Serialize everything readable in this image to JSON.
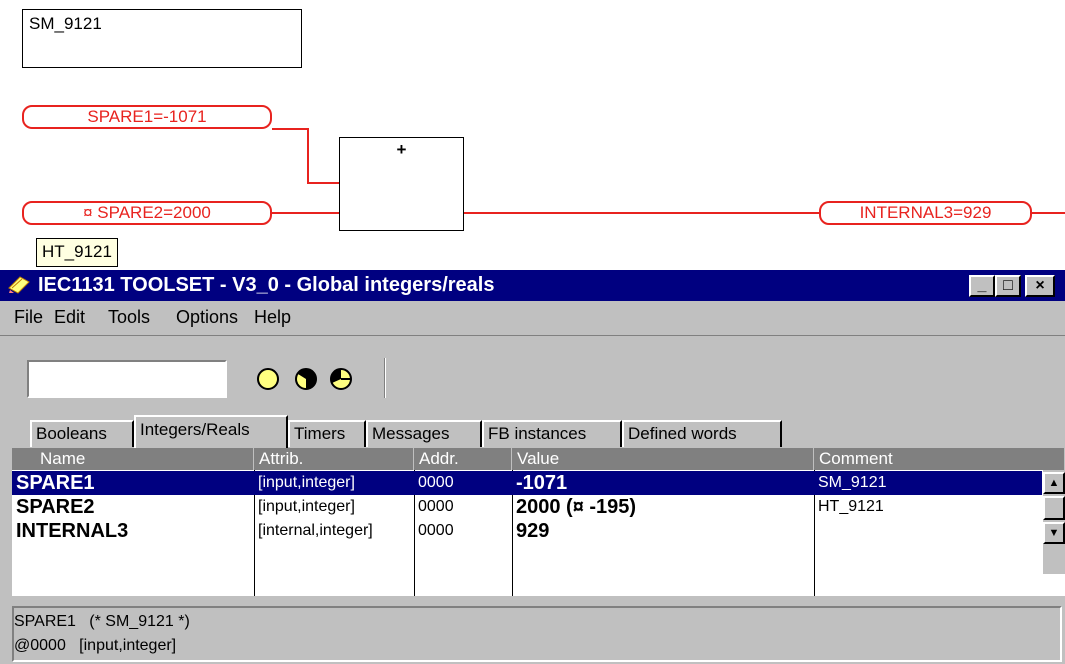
{
  "diagram": {
    "comment_box": "SM_9121",
    "pills": {
      "spare1": "SPARE1=-1071",
      "spare2": "¤ SPARE2=2000",
      "internal3": "INTERNAL3=929"
    },
    "block_symbol": "+",
    "tooltip": "HT_9121",
    "wire_color": "#e8231f"
  },
  "window": {
    "title": "IEC1131 TOOLSET - V3_0 - Global integers/reals",
    "title_icon": "pencil-ruler-icon",
    "titlebar_color": "#000080",
    "controls": {
      "minimize": "_",
      "maximize": "□",
      "close": "×"
    },
    "menu": [
      "File",
      "Edit",
      "Tools",
      "Options",
      "Help"
    ],
    "toolbar": {
      "search_value": "",
      "icons": [
        "circle-yellow-icon",
        "circle-half-icon",
        "circle-pie-icon"
      ]
    },
    "tabs": [
      "Booleans",
      "Integers/Reals",
      "Timers",
      "Messages",
      "FB instances",
      "Defined words"
    ],
    "active_tab": "Integers/Reals",
    "grid": {
      "columns": [
        "Name",
        "Attrib.",
        "Addr.",
        "Value",
        "Comment"
      ],
      "rows": [
        {
          "name": "SPARE1",
          "attrib": "[input,integer]",
          "addr": "0000",
          "value": "-1071",
          "comment": "SM_9121",
          "selected": true
        },
        {
          "name": "SPARE2",
          "attrib": "[input,integer]",
          "addr": "0000",
          "value": "2000  (¤ -195)",
          "comment": "HT_9121",
          "selected": false
        },
        {
          "name": "INTERNAL3",
          "attrib": "[internal,integer]",
          "addr": "0000",
          "value": "929",
          "comment": "",
          "selected": false
        }
      ]
    },
    "info": {
      "line1": "SPARE1   (* SM_9121 *)",
      "line2": "@0000   [input,integer]"
    }
  }
}
